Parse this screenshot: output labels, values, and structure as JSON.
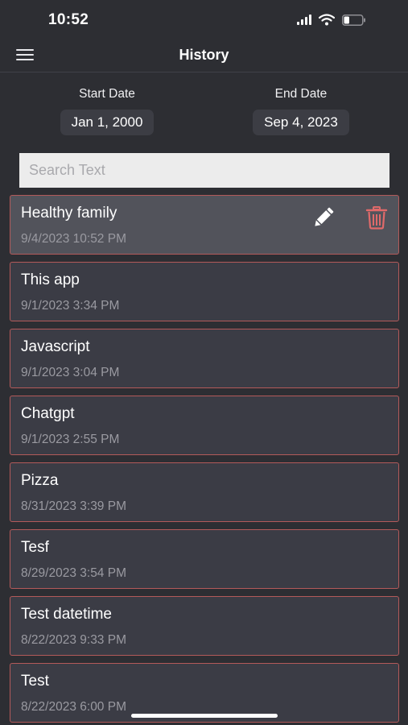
{
  "status_bar": {
    "time": "10:52",
    "battery_level": 0.3
  },
  "nav": {
    "title": "History",
    "menu_icon": "hamburger-menu-icon"
  },
  "filters": {
    "start_label": "Start Date",
    "start_value": "Jan 1, 2000",
    "end_label": "End Date",
    "end_value": "Sep 4, 2023"
  },
  "search": {
    "placeholder": "Search Text",
    "value": ""
  },
  "history": {
    "items": [
      {
        "title": "Healthy family",
        "date": "9/4/2023 10:52 PM",
        "selected": true
      },
      {
        "title": "This app",
        "date": "9/1/2023 3:34 PM"
      },
      {
        "title": "Javascript",
        "date": "9/1/2023 3:04 PM"
      },
      {
        "title": "Chatgpt",
        "date": "9/1/2023 2:55 PM"
      },
      {
        "title": "Pizza",
        "date": "8/31/2023 3:39 PM"
      },
      {
        "title": "Tesf",
        "date": "8/29/2023 3:54 PM"
      },
      {
        "title": "Test datetime",
        "date": "8/22/2023 9:33 PM"
      },
      {
        "title": "Test",
        "date": "8/22/2023 6:00 PM"
      }
    ],
    "edit_icon": "pencil-icon",
    "delete_icon": "trash-icon"
  },
  "colors": {
    "background": "#2d2e33",
    "item_background": "#3b3c45",
    "item_selected_background": "#52535b",
    "item_border": "#b35a5a",
    "delete_icon": "#e06a6a",
    "date_text": "#9a9aa1"
  }
}
